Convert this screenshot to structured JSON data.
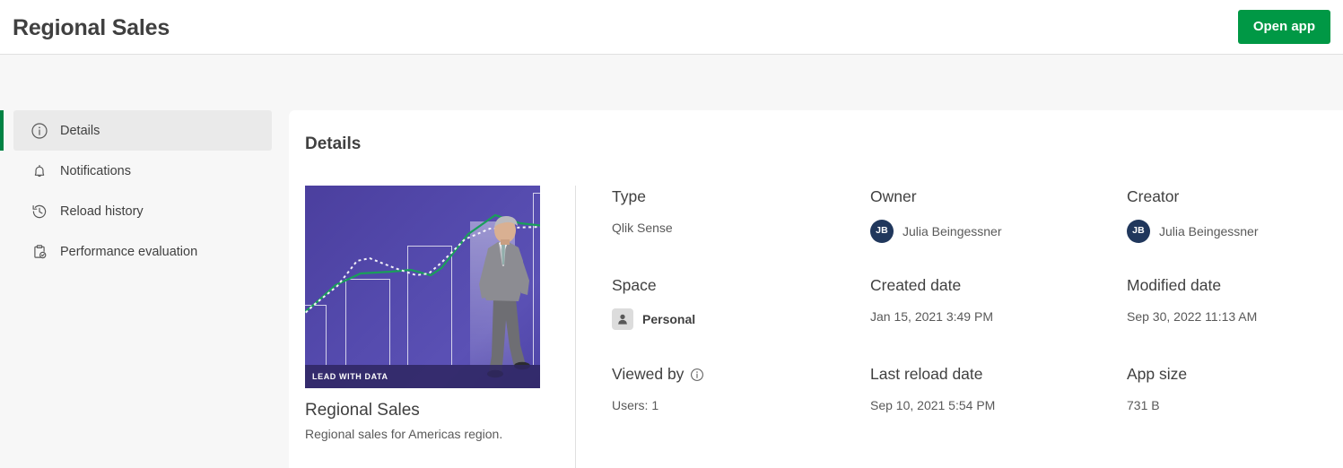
{
  "header": {
    "title": "Regional Sales",
    "open_app_label": "Open app"
  },
  "sidebar": {
    "items": [
      {
        "label": "Details",
        "icon": "info-circle-icon",
        "selected": true
      },
      {
        "label": "Notifications",
        "icon": "bell-icon",
        "selected": false
      },
      {
        "label": "Reload history",
        "icon": "history-clock-icon",
        "selected": false
      },
      {
        "label": "Performance evaluation",
        "icon": "clipboard-check-icon",
        "selected": false
      }
    ]
  },
  "main": {
    "heading": "Details",
    "thumbnail": {
      "banner_text": "LEAD WITH DATA",
      "alt": "purple chart background with businessman"
    },
    "app_name": "Regional Sales",
    "app_description": "Regional sales for Americas region.",
    "fields": {
      "type": {
        "label": "Type",
        "value": "Qlik Sense"
      },
      "owner": {
        "label": "Owner",
        "initials": "JB",
        "value": "Julia Beingessner"
      },
      "creator": {
        "label": "Creator",
        "initials": "JB",
        "value": "Julia Beingessner"
      },
      "space": {
        "label": "Space",
        "value": "Personal",
        "icon": "person-icon"
      },
      "created_date": {
        "label": "Created date",
        "value": "Jan 15, 2021 3:49 PM"
      },
      "modified_date": {
        "label": "Modified date",
        "value": "Sep 30, 2022 11:13 AM"
      },
      "viewed_by": {
        "label": "Viewed by",
        "value": "Users: 1",
        "info_icon": "info-circle-icon"
      },
      "last_reload_date": {
        "label": "Last reload date",
        "value": "Sep 10, 2021 5:54 PM"
      },
      "app_size": {
        "label": "App size",
        "value": "731 B"
      }
    }
  },
  "colors": {
    "accent_green": "#009845",
    "selected_indicator": "#008243",
    "avatar_navy": "#20375c",
    "text_primary": "#404040",
    "text_secondary": "#595959",
    "thumbnail_purple": "#544aad"
  }
}
